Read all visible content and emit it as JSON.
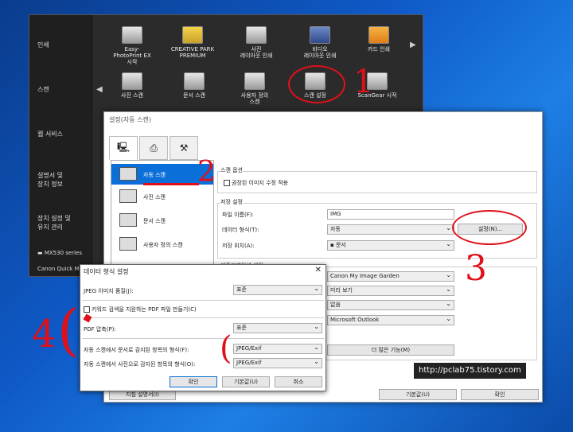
{
  "quick_menu": {
    "side_items": [
      "인쇄",
      "스캔",
      "웹 서비스",
      "설명서 및\n장치 정보",
      "장치 설정 및\n유지 관리"
    ],
    "model": "MX530 series",
    "footer": "Canon Quick M",
    "print_row": [
      {
        "icon": "easy-photoprint-icon",
        "label": "Easy-\nPhotoPrint EX\n시작"
      },
      {
        "icon": "creative-park-icon",
        "label": "CREATIVE PARK\nPREMIUM"
      },
      {
        "icon": "photo-layout-icon",
        "label": "사진\n레이아웃 인쇄"
      },
      {
        "icon": "video-layout-icon",
        "label": "비디오\n레이아웃 인쇄"
      },
      {
        "icon": "card-print-icon",
        "label": "카드 인쇄"
      }
    ],
    "scan_row": [
      {
        "icon": "photo-scan-icon",
        "label": "사진 스캔"
      },
      {
        "icon": "document-scan-icon",
        "label": "문서 스캔"
      },
      {
        "icon": "custom-scan-icon",
        "label": "사용자 정의\n스캔"
      },
      {
        "icon": "scan-settings-icon",
        "label": "스캔 설정"
      },
      {
        "icon": "scangear-icon",
        "label": "ScanGear 시작"
      }
    ]
  },
  "settings": {
    "title": "설정(자동 스캔)",
    "left_items": [
      "자동 스캔",
      "사진 스캔",
      "문서 스캔",
      "사용자 정의 스캔"
    ],
    "scan_options_label": "스캔 옵션",
    "apply_correction": "권장된 이미지 수정 적용",
    "save_settings_label": "저장 설정",
    "file_name_label": "파일 이름(F):",
    "file_name_value": "IMG",
    "data_format_label": "데이터 형식(T):",
    "data_format_value": "자동",
    "settings_button": "설정(N)...",
    "save_location_label": "저장 위치(A):",
    "save_location_value": "문서",
    "app_settings_label": "애플리케이션 설정",
    "app_values": [
      "Canon My Image Garden",
      "미리 보기",
      "없음",
      "Microsoft Outlook"
    ],
    "more_functions_button": "더 많은 기능(M)",
    "instructions_button": "지침 설명서(I)",
    "defaults_button": "기본값(U)",
    "ok_button": "확인"
  },
  "dialog": {
    "title": "데이터 형식 설정",
    "jpeg_quality_label": "JPEG 이미지 품질(J):",
    "jpeg_quality_value": "표준",
    "keyword_pdf": "키워드 검색을 지원하는 PDF 파일 만들기(C)",
    "pdf_compression_label": "PDF 압축(P):",
    "pdf_compression_value": "표준",
    "doc_format_label": "자동 스캔에서 문서로 감지된 항목의 형식(F):",
    "doc_format_value": "JPEG/Exif",
    "photo_format_label": "자동 스캔에서 사진으로 감지된 항목의 형식(O):",
    "photo_format_value": "JPEG/Exif",
    "ok": "확인",
    "defaults": "기본값(U)",
    "cancel": "취소"
  },
  "annotations": [
    "1",
    "2",
    "3",
    "4"
  ],
  "watermark": "http://pclab75.tistory.com",
  "colors": {
    "annotation": "#e0101a",
    "selection": "#0a6fd8"
  }
}
